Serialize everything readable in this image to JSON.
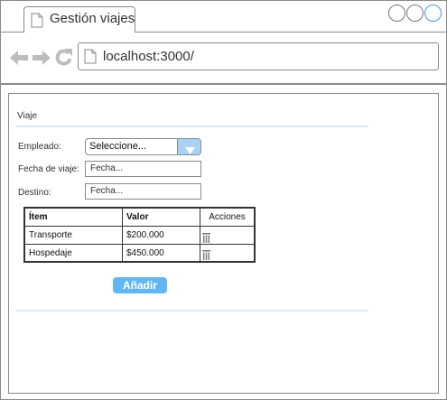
{
  "browser": {
    "tab_title": "Gestión viajes",
    "address": "localhost:3000/"
  },
  "icons": {
    "tab": "page-icon",
    "address": "page-icon",
    "back": "back-arrow-icon",
    "forward": "forward-arrow-icon",
    "reload": "reload-icon",
    "select": "chevron-down-icon",
    "row_action": "trash-icon"
  },
  "colors": {
    "accent": "#62b7f3",
    "select_button": "#a9d2f3",
    "window_close": "#3b9bd6",
    "divider": "#d6ebf7"
  },
  "form": {
    "section_title": "Viaje",
    "empleado_label": "Empleado:",
    "empleado_value": "Seleccione...",
    "fecha_label": "Fecha de viaje:",
    "fecha_placeholder": "Fecha...",
    "destino_label": "Destino:",
    "destino_placeholder": "Fecha...",
    "add_button": "Añadir"
  },
  "table": {
    "headers": [
      "Ítem",
      "Valor",
      "Acciones"
    ],
    "rows": [
      {
        "item": "Transporte",
        "valor": "$200.000"
      },
      {
        "item": "Hospedaje",
        "valor": "$450.000"
      }
    ]
  }
}
